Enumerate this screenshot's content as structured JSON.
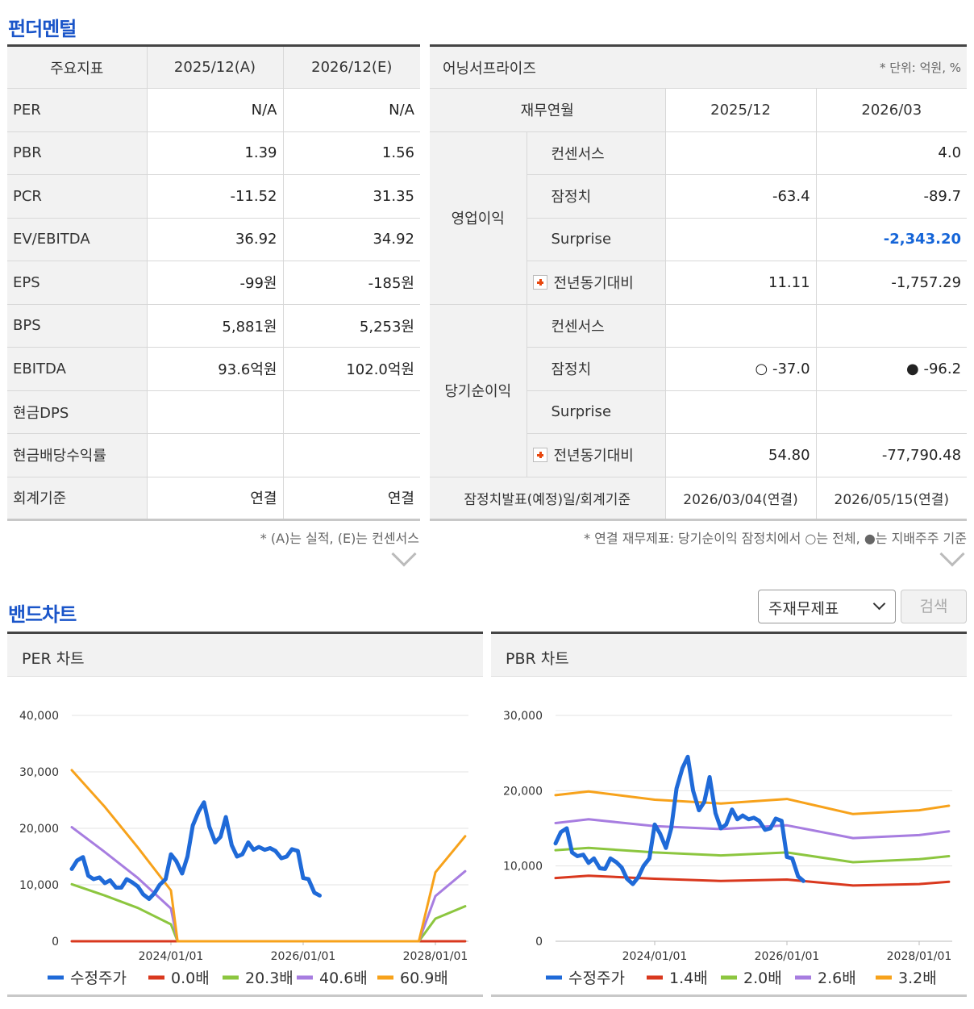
{
  "fundamentals": {
    "title": "펀더멘털",
    "header": [
      "주요지표",
      "2025/12(A)",
      "2026/12(E)"
    ],
    "rows": [
      [
        "PER",
        "N/A",
        "N/A"
      ],
      [
        "PBR",
        "1.39",
        "1.56"
      ],
      [
        "PCR",
        "-11.52",
        "31.35"
      ],
      [
        "EV/EBITDA",
        "36.92",
        "34.92"
      ],
      [
        "EPS",
        "-99원",
        "-185원"
      ],
      [
        "BPS",
        "5,881원",
        "5,253원"
      ],
      [
        "EBITDA",
        "93.6억원",
        "102.0억원"
      ],
      [
        "현금DPS",
        "",
        ""
      ],
      [
        "현금배당수익률",
        "",
        ""
      ],
      [
        "회계기준",
        "연결",
        "연결"
      ]
    ],
    "note": "* (A)는 실적, (E)는 컨센서스"
  },
  "earnings": {
    "title": "어닝서프라이즈",
    "unit": "* 단위: 억원, %",
    "header": [
      "재무연월",
      "2025/12",
      "2026/03"
    ],
    "op_group": "영업이익",
    "op_rows": [
      [
        "컨센서스",
        "",
        "4.0"
      ],
      [
        "잠정치",
        "-63.4",
        "-89.7"
      ],
      [
        "Surprise",
        "",
        "-2,343.20"
      ],
      [
        "전년동기대비",
        "11.11",
        "-1,757.29"
      ]
    ],
    "ni_group": "당기순이익",
    "ni_rows": [
      [
        "컨센서스",
        "",
        ""
      ],
      [
        "잠정치",
        "○ -37.0",
        "● -96.2"
      ],
      [
        "Surprise",
        "",
        ""
      ],
      [
        "전년동기대비",
        "54.80",
        "-77,790.48"
      ]
    ],
    "footer": [
      "잠정치발표(예정)일/회계기준",
      "2026/03/04(연결)",
      "2026/05/15(연결)"
    ],
    "note": "* 연결 재무제표: 당기순이익 잠정치에서 ○는 전체, ●는 지배주주 기준",
    "accent_color": "#1565d8"
  },
  "band": {
    "title": "밴드차트",
    "select_value": "주재무제표",
    "search_label": "검색"
  },
  "chart_data": [
    {
      "type": "line",
      "title": "PER 차트",
      "ylim": [
        0,
        40000
      ],
      "yticks": [
        0,
        10000,
        20000,
        30000,
        40000
      ],
      "ytick_labels": [
        "0",
        "10,000",
        "20,000",
        "30,000",
        "40,000"
      ],
      "xlim": [
        2022.5,
        2028.5
      ],
      "xticks": [
        2024,
        2026,
        2028
      ],
      "xtick_labels": [
        "2024/01/01",
        "2026/01/01",
        "2028/01/01"
      ],
      "grid": true,
      "legend": "bottom",
      "series": [
        {
          "name": "수정주가",
          "color": "#1f6ad8",
          "width": 5,
          "x": [
            2022.5,
            2022.58,
            2022.67,
            2022.75,
            2022.83,
            2022.92,
            2023.0,
            2023.08,
            2023.17,
            2023.25,
            2023.33,
            2023.42,
            2023.5,
            2023.58,
            2023.67,
            2023.75,
            2023.83,
            2023.92,
            2024.0,
            2024.08,
            2024.17,
            2024.25,
            2024.33,
            2024.42,
            2024.5,
            2024.58,
            2024.67,
            2024.75,
            2024.83,
            2024.92,
            2025.0,
            2025.08,
            2025.17,
            2025.25,
            2025.33,
            2025.42,
            2025.5,
            2025.58,
            2025.67,
            2025.75,
            2025.83,
            2025.92,
            2026.0,
            2026.08,
            2026.17,
            2026.25,
            2026.33,
            2026.42,
            2026.5
          ],
          "y": [
            12800,
            14300,
            14900,
            11600,
            11000,
            11300,
            10300,
            10800,
            9500,
            9500,
            11000,
            10400,
            9700,
            8300,
            7500,
            8500,
            10000,
            11000,
            15400,
            14200,
            12000,
            15000,
            20500,
            23000,
            24600,
            20300,
            17500,
            18500,
            22000,
            17000,
            15000,
            15400,
            17500,
            16200,
            16700,
            16200,
            16500,
            16000,
            14700,
            15000,
            16300,
            16000,
            11200,
            11000,
            8600,
            8100,
            null,
            null,
            null
          ]
        },
        {
          "name": "0.0배",
          "color": "#d9381e",
          "width": 3,
          "x": [
            2022.5,
            2028.45
          ],
          "y": [
            0,
            0
          ]
        },
        {
          "name": "20.3배",
          "color": "#8cc63f",
          "width": 3,
          "x": [
            2022.5,
            2023.0,
            2023.5,
            2024.0,
            2024.1,
            2024.15,
            2027.75,
            2028.0,
            2028.45
          ],
          "y": [
            10100,
            8100,
            5900,
            3000,
            0,
            0,
            0,
            4000,
            6200
          ]
        },
        {
          "name": "40.6배",
          "color": "#a77de0",
          "width": 3,
          "x": [
            2022.5,
            2023.0,
            2023.5,
            2024.0,
            2024.1,
            2024.15,
            2027.75,
            2028.0,
            2028.45
          ],
          "y": [
            20200,
            15800,
            11200,
            5800,
            0,
            0,
            0,
            8000,
            12400
          ]
        },
        {
          "name": "60.9배",
          "color": "#f7a21b",
          "width": 3,
          "x": [
            2022.5,
            2023.0,
            2023.5,
            2024.0,
            2024.1,
            2024.15,
            2027.75,
            2028.0,
            2028.45
          ],
          "y": [
            30300,
            23800,
            16600,
            9000,
            0,
            0,
            0,
            12200,
            18600
          ]
        }
      ]
    },
    {
      "type": "line",
      "title": "PBR 차트",
      "ylim": [
        0,
        30000
      ],
      "yticks": [
        0,
        10000,
        20000,
        30000
      ],
      "ytick_labels": [
        "0",
        "10,000",
        "20,000",
        "30,000"
      ],
      "xlim": [
        2022.5,
        2028.5
      ],
      "xticks": [
        2024,
        2026,
        2028
      ],
      "xtick_labels": [
        "2024/01/01",
        "2026/01/01",
        "2028/01/01"
      ],
      "grid": true,
      "legend": "bottom",
      "series": [
        {
          "name": "수정주가",
          "color": "#1f6ad8",
          "width": 5,
          "x": [
            2022.5,
            2022.58,
            2022.67,
            2022.75,
            2022.83,
            2022.92,
            2023.0,
            2023.08,
            2023.17,
            2023.25,
            2023.33,
            2023.42,
            2023.5,
            2023.58,
            2023.67,
            2023.75,
            2023.83,
            2023.92,
            2024.0,
            2024.08,
            2024.17,
            2024.25,
            2024.33,
            2024.42,
            2024.5,
            2024.58,
            2024.67,
            2024.75,
            2024.83,
            2024.92,
            2025.0,
            2025.08,
            2025.17,
            2025.25,
            2025.33,
            2025.42,
            2025.5,
            2025.58,
            2025.67,
            2025.75,
            2025.83,
            2025.92,
            2026.0,
            2026.08,
            2026.17,
            2026.25
          ],
          "y": [
            13000,
            14500,
            15000,
            11800,
            11300,
            11500,
            10400,
            11000,
            9700,
            9600,
            11000,
            10500,
            9800,
            8300,
            7600,
            8500,
            10000,
            11000,
            15500,
            14300,
            12400,
            15000,
            20300,
            23000,
            24500,
            20000,
            17400,
            18500,
            21800,
            17000,
            15000,
            15500,
            17500,
            16200,
            16700,
            16200,
            16400,
            16000,
            14800,
            15000,
            16300,
            16000,
            11200,
            11000,
            8600,
            8000
          ]
        },
        {
          "name": "1.4배",
          "color": "#d9381e",
          "width": 3,
          "x": [
            2022.5,
            2023.0,
            2024.0,
            2025.0,
            2026.0,
            2027.0,
            2028.0,
            2028.45
          ],
          "y": [
            8400,
            8700,
            8300,
            8000,
            8200,
            7400,
            7600,
            7900
          ]
        },
        {
          "name": "2.0배",
          "color": "#8cc63f",
          "width": 3,
          "x": [
            2022.5,
            2023.0,
            2024.0,
            2025.0,
            2026.0,
            2027.0,
            2028.0,
            2028.45
          ],
          "y": [
            12100,
            12400,
            11800,
            11400,
            11800,
            10500,
            10900,
            11300
          ]
        },
        {
          "name": "2.6배",
          "color": "#a77de0",
          "width": 3,
          "x": [
            2022.5,
            2023.0,
            2024.0,
            2025.0,
            2026.0,
            2027.0,
            2028.0,
            2028.45
          ],
          "y": [
            15700,
            16200,
            15300,
            14900,
            15400,
            13700,
            14100,
            14600
          ]
        },
        {
          "name": "3.2배",
          "color": "#f7a21b",
          "width": 3,
          "x": [
            2022.5,
            2023.0,
            2024.0,
            2025.0,
            2026.0,
            2027.0,
            2028.0,
            2028.45
          ],
          "y": [
            19400,
            19900,
            18800,
            18300,
            18900,
            16900,
            17400,
            18000
          ]
        }
      ]
    }
  ]
}
